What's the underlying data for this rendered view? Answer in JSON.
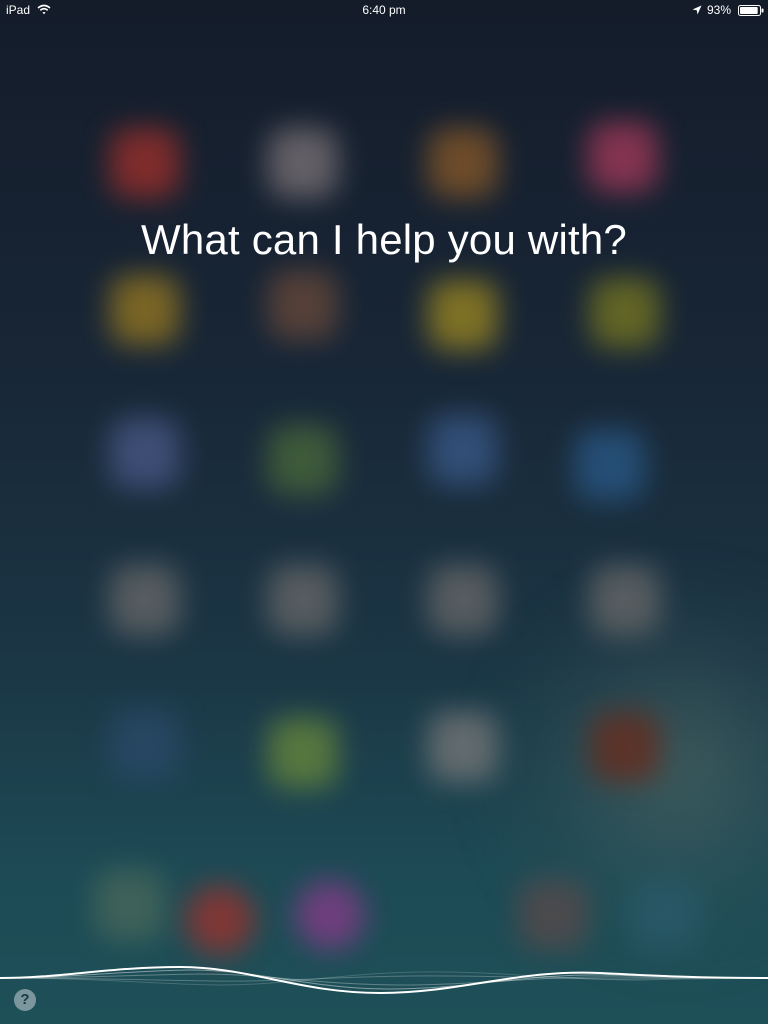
{
  "status_bar": {
    "device": "iPad",
    "time": "6:40 pm",
    "battery": "93%",
    "battery_level": 0.93,
    "icons": [
      "wifi-icon",
      "location-arrow-icon",
      "battery-icon"
    ]
  },
  "siri": {
    "prompt": "What can I help you with?",
    "help_label": "?",
    "icons": [
      "waveform-icon",
      "help-icon"
    ]
  },
  "colors": {
    "text": "#ffffff",
    "background_top": "#141c2a",
    "background_bottom": "#1e5058"
  }
}
